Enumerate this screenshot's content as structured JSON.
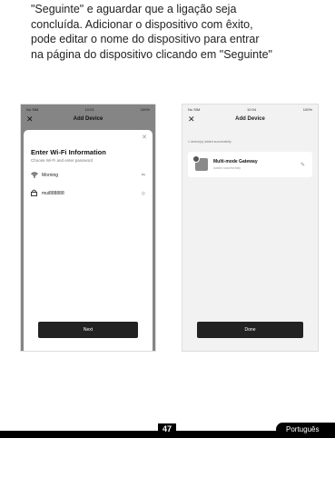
{
  "paragraph": {
    "lines": [
      "\"Seguinte\" e aguardar que a ligação seja",
      "concluída. Adicionar o dispositivo com êxito,",
      "pode editar o nome do dispositivo para entrar",
      "na página do dispositivo clicando em \"Seguinte\""
    ]
  },
  "phone1": {
    "status_left": "No SIM",
    "status_center": "10:02",
    "status_right": "100%",
    "nav_close": "✕",
    "nav_title": "Add Device",
    "sheet_close": "✕",
    "sheet_title": "Enter Wi-Fi Information",
    "sheet_subtitle": "Choose Wi-Fi and enter password",
    "wifi_name": "Morning",
    "wifi_tail": "⇆",
    "password": "mui888888",
    "password_tail": "◎",
    "next_button": "Next"
  },
  "phone2": {
    "status_left": "No SIM",
    "status_center": "10:04",
    "status_right": "100%",
    "nav_close": "✕",
    "nav_title": "Add Device",
    "hint": "1 device(s) added successfully",
    "device_name": "Multi-mode Gateway",
    "device_status": "Added successfully",
    "edit_icon": "✎",
    "done_button": "Done"
  },
  "footer": {
    "page_number": "47",
    "language": "Português"
  }
}
